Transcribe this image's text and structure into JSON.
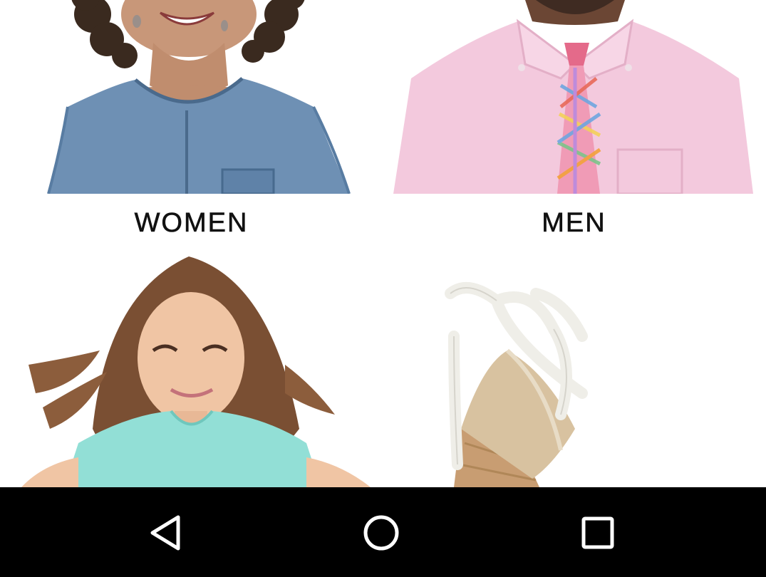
{
  "categories": [
    {
      "label": "WOMEN",
      "image": "woman-in-denim-top"
    },
    {
      "label": "MEN",
      "image": "man-in-pink-shirt-and-plaid-tie"
    },
    {
      "label": "",
      "image": "girl-in-mint-tee"
    },
    {
      "label": "",
      "image": "lace-up-espadrille-wedge-sandal"
    }
  ],
  "navigation_bar": {
    "back_icon": "triangle-back-icon",
    "home_icon": "circle-home-icon",
    "recents_icon": "square-recents-icon",
    "color": "#000000"
  }
}
